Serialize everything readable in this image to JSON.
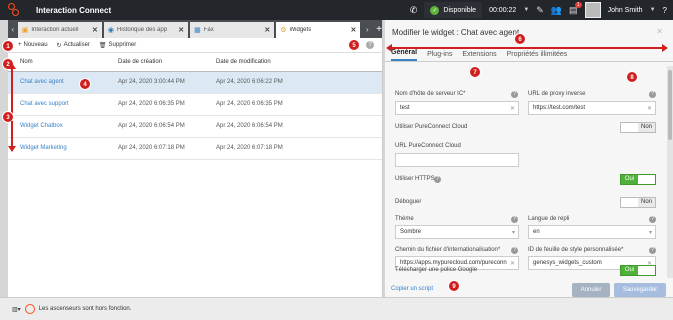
{
  "header": {
    "app_title": "Interaction Connect",
    "status": "Disponible",
    "timer": "00:00:22",
    "notification_count": "1",
    "user": "John Smith",
    "help": "?"
  },
  "tabs": [
    {
      "label": "Interaction actuell",
      "icon": "interaction-icon"
    },
    {
      "label": "Historique des app",
      "icon": "history-icon"
    },
    {
      "label": "Fax",
      "icon": "fax-icon"
    },
    {
      "label": "Widgets",
      "icon": "widgets-icon"
    }
  ],
  "toolbar": {
    "new": "Nouveau",
    "refresh": "Actualiser",
    "delete": "Supprimer"
  },
  "table": {
    "columns": [
      "Nom",
      "Date de création",
      "Date de modification"
    ],
    "rows": [
      [
        "Chat avec agent",
        "Apr 24, 2020 3:00:44 PM",
        "Apr 24, 2020 6:06:22 PM"
      ],
      [
        "Chat avec support",
        "Apr 24, 2020 6:06:35 PM",
        "Apr 24, 2020 6:06:35 PM"
      ],
      [
        "Widget Chatbox",
        "Apr 24, 2020 6:06:54 PM",
        "Apr 24, 2020 6:06:54 PM"
      ],
      [
        "Widget Marketing",
        "Apr 24, 2020 6:07:18 PM",
        "Apr 24, 2020 6:07:18 PM"
      ]
    ]
  },
  "statusbar": {
    "message": "Les ascenseurs sont hors fonction."
  },
  "dialog": {
    "title": "Modifier le widget : Chat avec agent",
    "tabs": [
      "Général",
      "Plug-ins",
      "Extensions",
      "Propriétés illimitées"
    ],
    "fields": {
      "hostname_label": "Nom d'hôte de serveur IC*",
      "hostname_value": "test",
      "proxy_label": "URL de proxy inverse",
      "proxy_value": "https://test.com/test",
      "use_cloud_label": "Utiliser PureConnect Cloud",
      "use_cloud_value": "Non",
      "cloud_url_label": "URL PureConnect Cloud",
      "cloud_url_value": "",
      "https_label": "Utiliser HTTPS",
      "https_value": "Oui",
      "debug_label": "Déboguer",
      "debug_value": "Non",
      "theme_label": "Thème",
      "theme_value": "Sombre",
      "fallback_label": "Langue de repli",
      "fallback_value": "en",
      "i18n_label": "Chemin du fichier d'internationalisation*",
      "i18n_value": "https://apps.mypurecloud.com/pureconn",
      "css_label": "ID de feuille de style personnalisée*",
      "css_value": "genesys_widgets_custom",
      "google_font_label": "Télécharger une police Google",
      "google_font_value": "Oui"
    },
    "copy_link": "Copier un script",
    "cancel": "Annuler",
    "save": "Sauvegarder"
  },
  "markers": [
    "1",
    "2",
    "3",
    "4",
    "5",
    "6",
    "7",
    "8",
    "9"
  ],
  "colors": {
    "accent": "#3a82c6",
    "logo": "#ff4f1f",
    "toggle_on": "#4fb13a",
    "marker": "#d11f1f",
    "header_bg": "#23262b"
  }
}
